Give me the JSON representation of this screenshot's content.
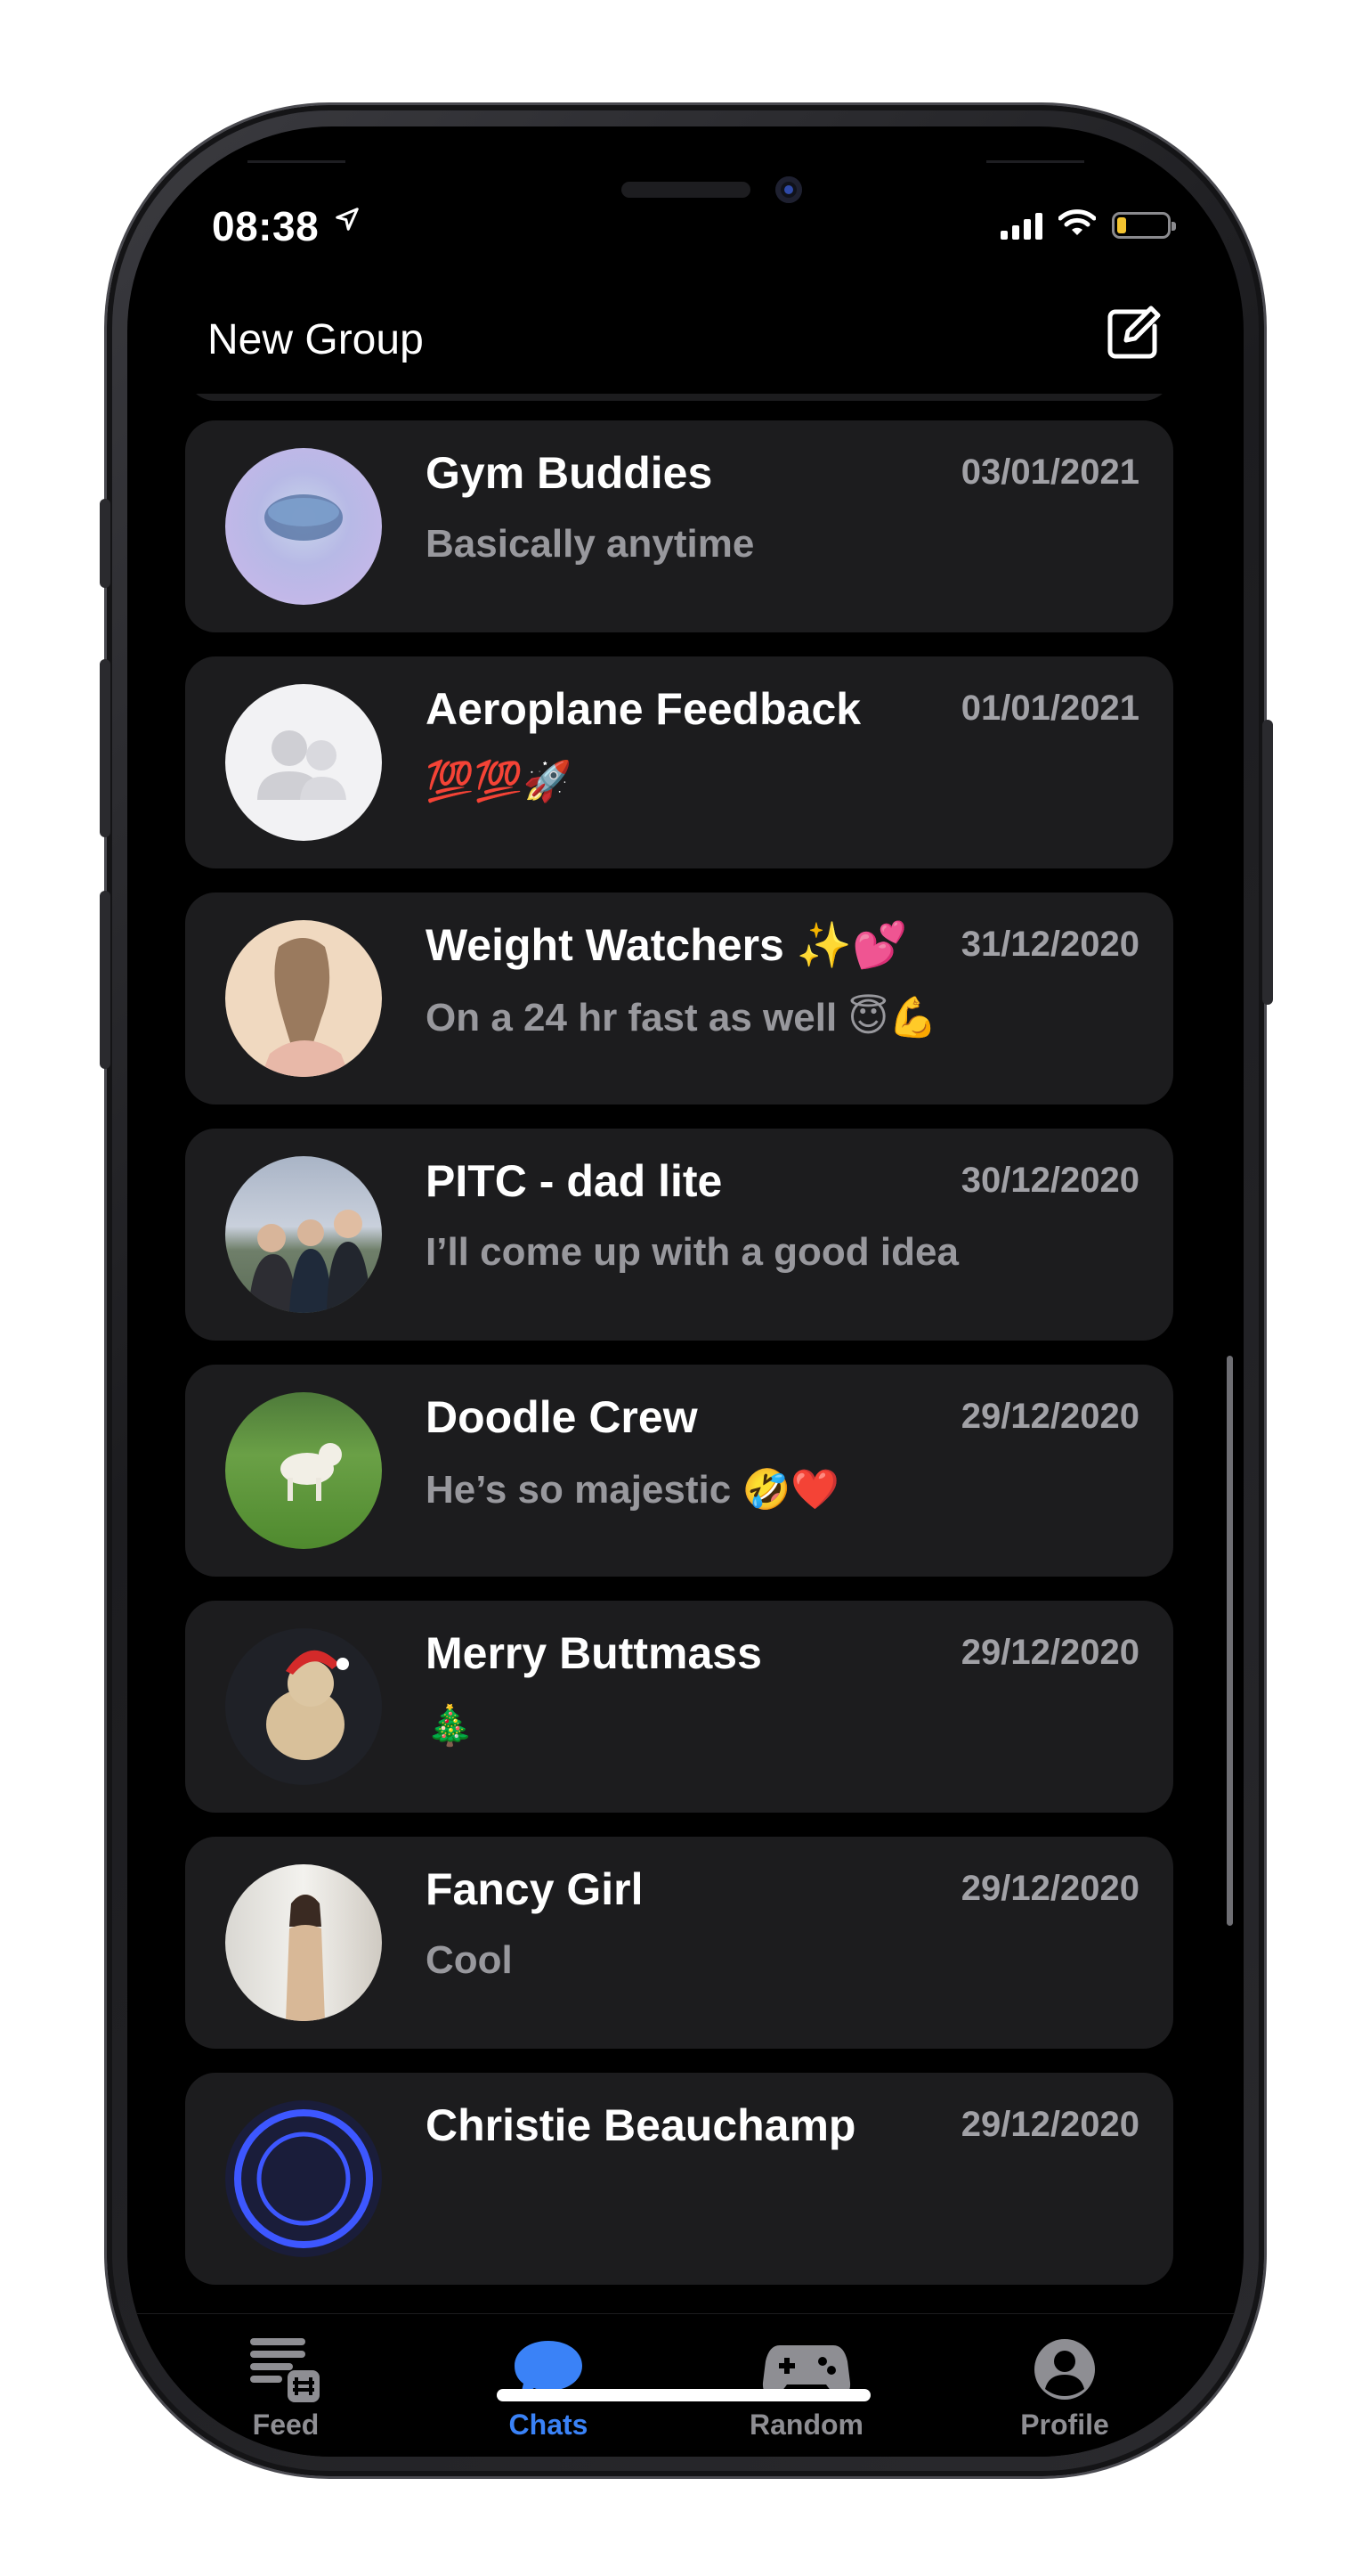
{
  "status_bar": {
    "time": "08:38",
    "location_arrow": "➤"
  },
  "header": {
    "title": "New Group",
    "compose_icon": "compose-icon"
  },
  "chats": [
    {
      "name": "Gym Buddies",
      "date": "03/01/2021",
      "message": "Basically anytime"
    },
    {
      "name": "Aeroplane Feedback",
      "date": "01/01/2021",
      "message": "💯💯🚀"
    },
    {
      "name": "Weight Watchers ✨💕",
      "date": "31/12/2020",
      "message": "On a 24 hr fast as well 😇💪"
    },
    {
      "name": "PITC - dad lite",
      "date": "30/12/2020",
      "message": "I’ll come up with a good idea"
    },
    {
      "name": "Doodle Crew",
      "date": "29/12/2020",
      "message": "He’s so majestic 🤣❤️"
    },
    {
      "name": "Merry Buttmass",
      "date": "29/12/2020",
      "message": "🎄"
    },
    {
      "name": "Fancy Girl",
      "date": "29/12/2020",
      "message": "Cool"
    },
    {
      "name": "Christie Beauchamp",
      "date": "29/12/2020",
      "message": ""
    }
  ],
  "tabs": [
    {
      "label": "Feed",
      "icon": "feed-icon",
      "active": false
    },
    {
      "label": "Chats",
      "icon": "chat-bubble-icon",
      "active": true
    },
    {
      "label": "Random",
      "icon": "gamepad-icon",
      "active": false
    },
    {
      "label": "Profile",
      "icon": "profile-icon",
      "active": false
    }
  ],
  "colors": {
    "active_tab": "#3a82f7",
    "inactive_tab": "#8e8e93",
    "card_bg": "#1c1c1e"
  }
}
